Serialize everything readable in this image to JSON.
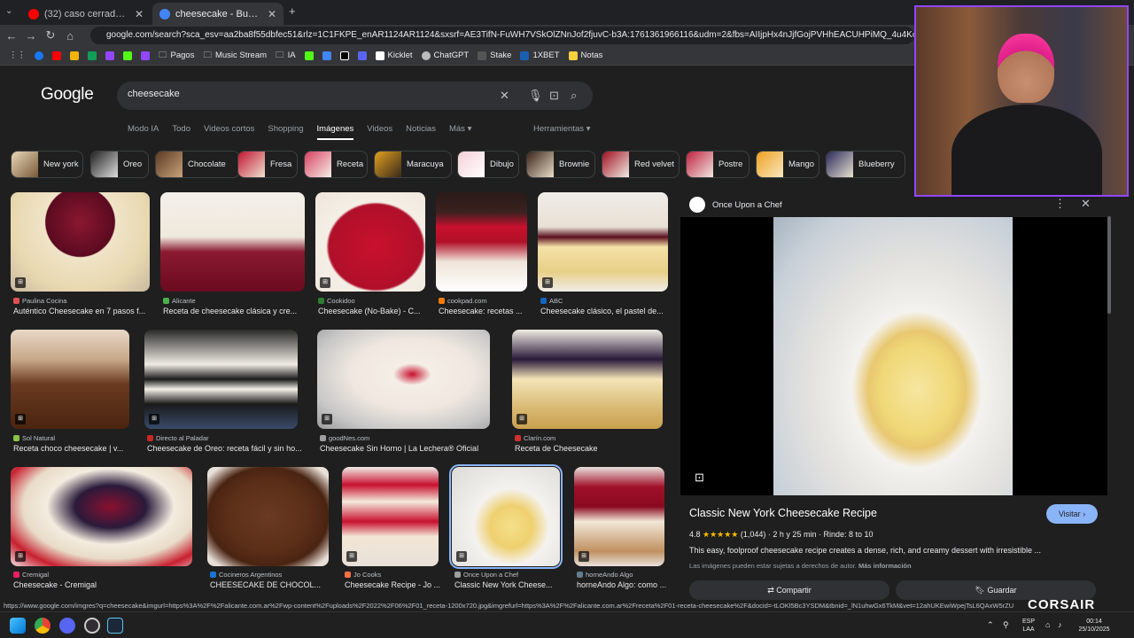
{
  "browser": {
    "tabs": [
      {
        "title": "(32) caso cerrado halloween - Y",
        "active": false,
        "favicon_color": "#ff0000"
      },
      {
        "title": "cheesecake - Buscar con Googl",
        "active": true,
        "favicon_color": "#4285f4"
      }
    ],
    "new_tab": "+",
    "url": "google.com/search?sca_esv=aa2ba8f55dbfec51&rlz=1C1FKPE_enAR1124AR1124&sxsrf=AE3TifN-FuWH7VSkOlZNnJof2fjuvC-b3A:1761361966116&udm=2&fbs=AIIjpHx4nJjfGojPVHhEACUHPiMQ_4u4Ko-HqjGhQ6Lh6-VOgBARyyHnP4EVk",
    "bookmarks": [
      "Pagos",
      "Music Stream",
      "IA",
      "Kicklet",
      "ChatGPT",
      "Stake",
      "1XBET",
      "Notas"
    ]
  },
  "google": {
    "logo": "Google",
    "query": "cheesecake",
    "nav_tabs": [
      "Modo IA",
      "Todo",
      "Videos cortos",
      "Shopping",
      "Imágenes",
      "Videos",
      "Noticias",
      "Más"
    ],
    "tools": "Herramientas",
    "chips": [
      "New york",
      "Oreo",
      "Chocolate",
      "Fresa",
      "Receta",
      "Maracuya",
      "Dibujo",
      "Brownie",
      "Red velvet",
      "Postre",
      "Mango",
      "Blueberry"
    ]
  },
  "results": [
    {
      "source": "Paulina Cocina",
      "caption": "Auténtico Cheesecake en 7 pasos f..."
    },
    {
      "source": "Alicante",
      "caption": "Receta de cheesecake clásica y cre..."
    },
    {
      "source": "Cookidoo",
      "caption": "Cheesecake (No-Bake) - C..."
    },
    {
      "source": "cookpad.com",
      "caption": "Cheesecake: recetas ..."
    },
    {
      "source": "ABC",
      "caption": "Cheesecake clásico, el pastel de..."
    },
    {
      "source": "Sol Natural",
      "caption": "Receta choco cheesecake | v..."
    },
    {
      "source": "Directo al Paladar",
      "caption": "Cheesecake de Oreo: receta fácil y sin ho..."
    },
    {
      "source": "goodNes.com",
      "caption": "Cheesecake Sin Horno | La Lechera® Oficial"
    },
    {
      "source": "Clarín.com",
      "caption": "Receta de Cheesecake"
    },
    {
      "source": "Cremigal",
      "caption": "Cheesecake - Cremigal"
    },
    {
      "source": "Cocineros Argentinos",
      "caption": "CHEESECAKE DE CHOCOL..."
    },
    {
      "source": "Jo Cooks",
      "caption": "Cheesecake Recipe - Jo ..."
    },
    {
      "source": "Once Upon a Chef",
      "caption": "Classic New York Cheese..."
    },
    {
      "source": "horneAndo Algo",
      "caption": "horneAndo Algo: como ..."
    }
  ],
  "panel": {
    "site": "Once Upon a Chef",
    "title": "Classic New York Cheesecake Recipe",
    "visit": "Visitar",
    "rating": "4.8",
    "stars": "★★★★★",
    "reviews": "(1,044)",
    "time": "2 h y 25 min",
    "servings": "Rinde: 8 to 10",
    "description": "This easy, foolproof cheesecake recipe creates a dense, rich, and creamy dessert with irresistible ...",
    "copyright": "Las imágenes pueden estar sujetas a derechos de autor.",
    "more_info": "Más información",
    "share": "Compartir",
    "save": "Guardar"
  },
  "status_url": "https://www.google.com/imgres?q=cheesecake&imgurl=https%3A%2F%2Falicante.com.ar%2Fwp-content%2Fuploads%2F2022%2F06%2F01_receta-1200x720.jpg&imgrefurl=https%3A%2F%2Falicante.com.ar%2Freceta%2F01-receta-cheesecake%2F&docid=-tLOKl5Bc3YSDM&tbnid=_lN1uhwGx6TkM&vet=12ahUKEwiWpejTsL6QAxW5rZU",
  "taskbar": {
    "lang1": "ESP",
    "lang2": "LAA",
    "time": "00:14",
    "date": "25/10/2025"
  },
  "overlay": {
    "brand": "CORSAIR"
  }
}
